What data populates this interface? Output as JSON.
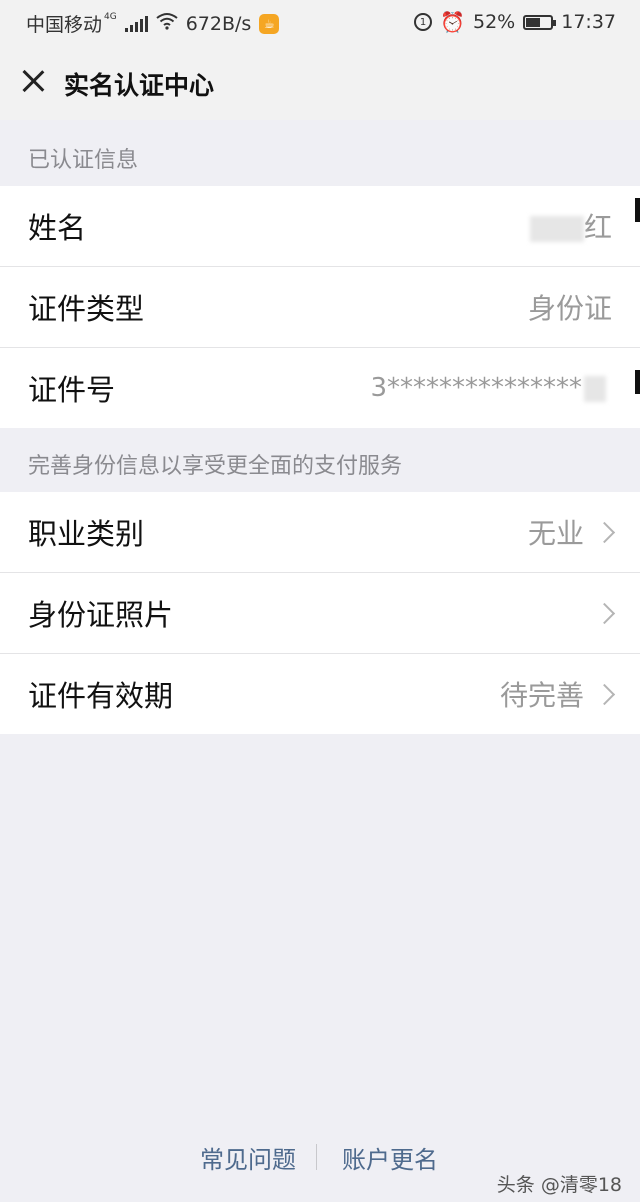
{
  "status_bar": {
    "carrier": "中国移动",
    "network": "4G",
    "speed": "672B/s",
    "battery": "52%",
    "battery_level": 0.52,
    "time": "17:37",
    "alarm_badge": "1"
  },
  "header": {
    "title": "实名认证中心"
  },
  "verified_section": {
    "heading": "已认证信息",
    "rows": [
      {
        "label": "姓名",
        "value": "红"
      },
      {
        "label": "证件类型",
        "value": "身份证"
      },
      {
        "label": "证件号",
        "value": "3***************"
      }
    ]
  },
  "complete_section": {
    "heading": "完善身份信息以享受更全面的支付服务",
    "rows": [
      {
        "label": "职业类别",
        "value": "无业"
      },
      {
        "label": "身份证照片",
        "value": ""
      },
      {
        "label": "证件有效期",
        "value": "待完善"
      }
    ]
  },
  "footer": {
    "faq": "常见问题",
    "rename": "账户更名"
  },
  "watermark": "头条 @清零18"
}
